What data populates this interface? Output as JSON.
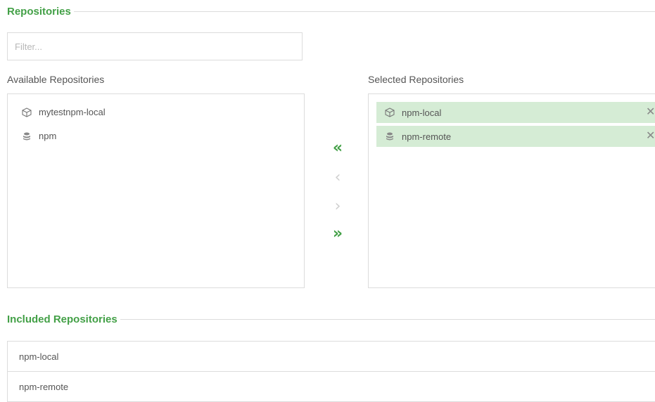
{
  "repositories_section": {
    "title": "Repositories",
    "filter": {
      "placeholder": "Filter...",
      "value": ""
    }
  },
  "available": {
    "label": "Available Repositories",
    "items": [
      {
        "name": "mytestnpm-local",
        "icon": "cube-icon"
      },
      {
        "name": "npm",
        "icon": "stack-icon"
      }
    ]
  },
  "selected": {
    "label": "Selected Repositories",
    "items": [
      {
        "name": "npm-local",
        "icon": "cube-icon",
        "remove_glyph": "✕"
      },
      {
        "name": "npm-remote",
        "icon": "stack-icon",
        "remove_glyph": "✕"
      }
    ],
    "highlight_color": "#d5ecd5"
  },
  "transfer_buttons": {
    "add_all": "«",
    "add_one": "‹",
    "remove_one": "›",
    "remove_all": "»"
  },
  "included_section": {
    "title": "Included Repositories",
    "rows": [
      "npm-local",
      "npm-remote"
    ]
  },
  "colors": {
    "accent": "#43a047",
    "border": "#dcdcdc",
    "text": "#555555"
  }
}
